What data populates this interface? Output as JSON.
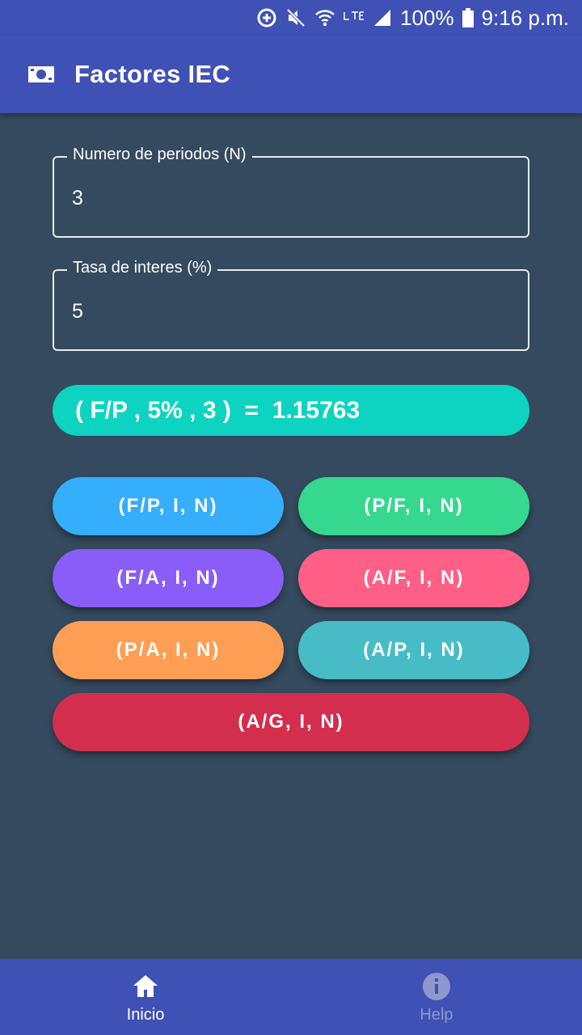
{
  "status_bar": {
    "battery": "100%",
    "time": "9:16 p.m.",
    "icons": [
      "data-saver-icon",
      "mute-icon",
      "wifi-icon",
      "lte-icon",
      "signal-icon",
      "battery-icon"
    ]
  },
  "app_bar": {
    "title": "Factores IEC",
    "icon": "money-icon"
  },
  "form": {
    "periods": {
      "label": "Numero de periodos (N)",
      "value": "3"
    },
    "rate": {
      "label": "Tasa de interes (%)",
      "value": "5"
    }
  },
  "result": {
    "text": "( F/P , 5% , 3 )  =  1.15763",
    "color": "#0DD3C1"
  },
  "factor_buttons": [
    {
      "label": "(F/P, I, N)",
      "color": "#35AEFB"
    },
    {
      "label": "(P/F, I, N)",
      "color": "#36D78E"
    },
    {
      "label": "(F/A, I, N)",
      "color": "#8A5CF8"
    },
    {
      "label": "(A/F, I, N)",
      "color": "#FE5F86"
    },
    {
      "label": "(P/A, I, N)",
      "color": "#FE9E54"
    },
    {
      "label": "(A/P, I, N)",
      "color": "#47BCC6"
    },
    {
      "label": "(A/G, I, N)",
      "color": "#D32E4D"
    }
  ],
  "bottom_nav": [
    {
      "label": "Inicio",
      "icon": "home-icon",
      "active": true
    },
    {
      "label": "Help",
      "icon": "info-icon",
      "active": false
    }
  ],
  "colors": {
    "primary": "#3F51B5",
    "background": "#354A5E",
    "nav_inactive": "#8E98CE"
  }
}
